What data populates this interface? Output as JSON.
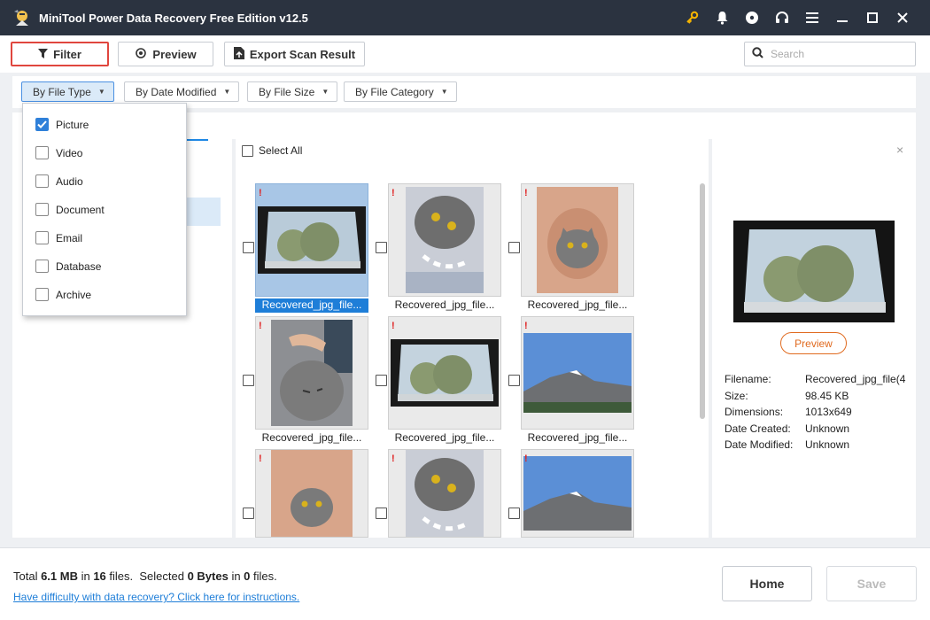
{
  "window": {
    "title": "MiniTool Power Data Recovery Free Edition v12.5"
  },
  "toolbar": {
    "filter_label": "Filter",
    "preview_label": "Preview",
    "export_label": "Export Scan Result",
    "search_placeholder": "Search"
  },
  "filters": {
    "by_file_type": "By File Type",
    "by_date_modified": "By Date Modified",
    "by_file_size": "By File Size",
    "by_file_category": "By File Category"
  },
  "file_type_menu": {
    "items": [
      {
        "label": "Picture",
        "checked": true
      },
      {
        "label": "Video",
        "checked": false
      },
      {
        "label": "Audio",
        "checked": false
      },
      {
        "label": "Document",
        "checked": false
      },
      {
        "label": "Email",
        "checked": false
      },
      {
        "label": "Database",
        "checked": false
      },
      {
        "label": "Archive",
        "checked": false
      }
    ]
  },
  "grid": {
    "select_all_label": "Select All",
    "items": [
      {
        "name": "Recovered_jpg_file...",
        "image": "car-window",
        "selected": true
      },
      {
        "name": "Recovered_jpg_file...",
        "image": "cat-upside",
        "selected": false
      },
      {
        "name": "Recovered_jpg_file...",
        "image": "cat-hands",
        "selected": false
      },
      {
        "name": "Recovered_jpg_file...",
        "image": "cat-petting",
        "selected": false
      },
      {
        "name": "Recovered_jpg_file...",
        "image": "car-window",
        "selected": false
      },
      {
        "name": "Recovered_jpg_file...",
        "image": "mountain",
        "selected": false
      },
      {
        "name": "",
        "image": "cat-hands",
        "selected": false
      },
      {
        "name": "",
        "image": "cat-upside",
        "selected": false
      },
      {
        "name": "",
        "image": "mountain",
        "selected": false
      }
    ]
  },
  "preview_panel": {
    "preview_button": "Preview",
    "close_glyph": "×",
    "meta": [
      {
        "key": "Filename:",
        "value": "Recovered_jpg_file(4"
      },
      {
        "key": "Size:",
        "value": "98.45 KB"
      },
      {
        "key": "Dimensions:",
        "value": "1013x649"
      },
      {
        "key": "Date Created:",
        "value": "Unknown"
      },
      {
        "key": "Date Modified:",
        "value": "Unknown"
      }
    ]
  },
  "footer": {
    "total_prefix": "Total ",
    "total_size": "6.1 MB",
    "total_in": " in ",
    "total_files": "16",
    "total_files_suffix": " files.",
    "selected_prefix": "  Selected ",
    "selected_size": "0 Bytes",
    "selected_in": " in ",
    "selected_files": "0",
    "selected_suffix": " files.",
    "help_link": "Have difficulty with data recovery? Click here for instructions.",
    "home_button": "Home",
    "save_button": "Save"
  },
  "colors": {
    "titlebar": "#2b3340",
    "accent_blue": "#1e7ed8",
    "filter_border_red": "#e0463e",
    "preview_orange": "#e06a1f",
    "warning_red": "#e02020"
  }
}
